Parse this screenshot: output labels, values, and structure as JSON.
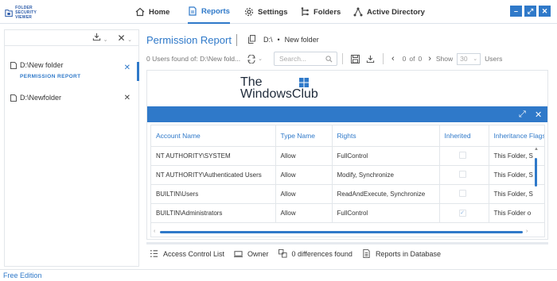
{
  "app": {
    "logo_text": [
      "FOLDER",
      "SECURITY",
      "VIEWER"
    ]
  },
  "nav": {
    "home": "Home",
    "reports": "Reports",
    "settings": "Settings",
    "folders": "Folders",
    "active_directory": "Active Directory"
  },
  "window_controls": {
    "min": "–",
    "restore": "⤢",
    "max": "⤡",
    "close": "✕"
  },
  "sidebar": {
    "items": [
      {
        "path": "D:\\New folder",
        "sub": "PERMISSION REPORT"
      },
      {
        "path": "D:\\Newfolder",
        "sub": ""
      }
    ]
  },
  "report": {
    "title": "Permission Report",
    "drive": "D:\\",
    "folder": "New folder",
    "users_found": "0 Users found of: D:\\New fold...",
    "search_placeholder": "Search...",
    "page_current": "0",
    "page_of": "of",
    "page_total": "0",
    "show_label": "Show",
    "show_value": "30",
    "users_label": "Users"
  },
  "watermark": {
    "line1": "The",
    "line2": "WindowsClub"
  },
  "grid": {
    "columns": [
      "Account Name",
      "Type Name",
      "Rights",
      "Inherited",
      "Inheritance Flags"
    ],
    "rows": [
      {
        "account": "NT AUTHORITY\\SYSTEM",
        "type": "Allow",
        "rights": "FullControl",
        "inherited": "",
        "flags": "This Folder, S"
      },
      {
        "account": "NT AUTHORITY\\Authenticated Users",
        "type": "Allow",
        "rights": "Modify, Synchronize",
        "inherited": "",
        "flags": "This Folder, S"
      },
      {
        "account": "BUILTIN\\Users",
        "type": "Allow",
        "rights": "ReadAndExecute, Synchronize",
        "inherited": "",
        "flags": "This Folder, S"
      },
      {
        "account": "BUILTIN\\Administrators",
        "type": "Allow",
        "rights": "FullControl",
        "inherited": "✓",
        "flags": "This Folder o"
      }
    ]
  },
  "bottom_tabs": {
    "acl": "Access Control List",
    "owner": "Owner",
    "diff": "0 differences found",
    "db": "Reports in Database"
  },
  "status": {
    "edition": "Free Edition"
  },
  "colors": {
    "accent": "#2f79c9"
  }
}
